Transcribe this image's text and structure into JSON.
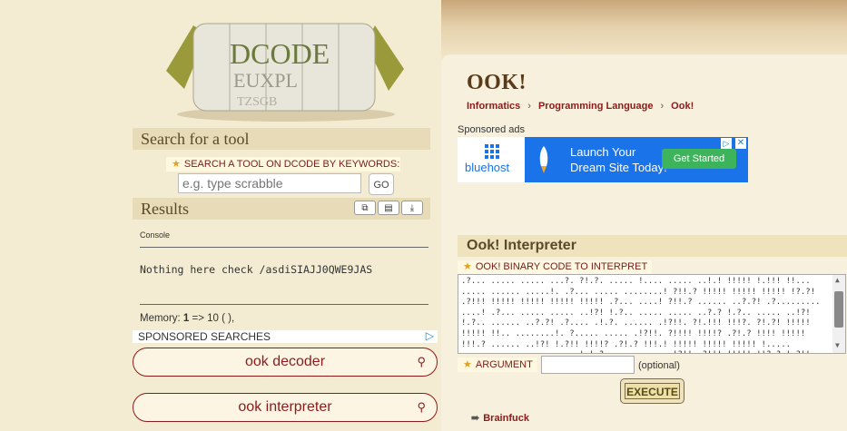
{
  "logo": {
    "letters_top": "DCODE",
    "letters_mid": "EUXPL",
    "letters_bot": "TZSGB"
  },
  "sidebar": {
    "search_header": "Search for a tool",
    "keyword_label": "SEARCH A TOOL ON DCODE BY KEYWORDS:",
    "search_placeholder": "e.g. type scrabble",
    "go_label": "GO",
    "results_header": "Results",
    "console_label": "Console",
    "console_text": "Nothing here check /asdiSIAJJ0QWE9JAS",
    "memory_prefix": "Memory: ",
    "memory_value": "1",
    "memory_suffix": " => 10 ( ),",
    "sponsored_searches": "SPONSORED SEARCHES",
    "ad_search_1": "ook decoder",
    "ad_search_2": "ook interpreter",
    "icons": [
      "copy-icon",
      "print-icon",
      "download-icon",
      "search-icon",
      "adchoices-icon"
    ]
  },
  "main": {
    "title": "OOK!",
    "breadcrumb": [
      "Informatics",
      "Programming Language",
      "Ook!"
    ],
    "sponsored_ads": "Sponsored ads",
    "ad": {
      "brand": "bluehost",
      "headline_1": "Launch Your",
      "headline_2": "Dream Site Today!",
      "cta": "Get Started"
    },
    "section_title": "Ook! Interpreter",
    "code_label": "OOK! BINARY CODE TO INTERPRET",
    "code_value": ".?... ..... ..... ...?. ?!.?. ..... !.... ..... ..!.! !!!!! !.!!! !!... ..... ...... .....!. .?... ..... ........! ?!!.? !!!!! !!!!! !!!!! !?.?! .?!!! !!!!! !!!!! !!!!! !!!!! .?... ....! ?!!.? ...... ..?.?! .?......... ....! .?... ..... ..... ..!?! !.?.. ..... ..... ..?.? !.?.. ..... ..!?! !.?.. ...... ..?.?! .?.... .!.?. ...... .!?!!. ?!.!!! !!!?. ?!.?! !!!!! !!!!! !!.. ........!. ?..... ..... .!?!!. ?!!!! !!!!? .?!.? !!!! !!!!! !!!.? ...... ..!?! !.?!! !!!!? .?!.? !!!.! !!!!! !!!!! !!!!! !..... ........ ...... ........!.!.? .... ...... .!?!! .?!!! !!!!! !!?.? !.?!! !.?.. ..... ...! ?!!.? ..... ..... ?.?!. ?...... ......!. ..... ......!.?. ...... ...!? !!.?! !!!!! !!?.? !.?!! !!!.? ...... .!?!.! !!!!? .?!.? !!!!! !!.? ......... !?.!! .? ......... ?.? !.? !!!.!!!! !!!! !!!!! !!!!! !.?.........!?!",
    "argument_label": "ARGUMENT",
    "argument_value": "",
    "optional": "(optional)",
    "execute": "EXECUTE",
    "related_link": "Brainfuck"
  },
  "colors": {
    "accent": "#8b1a1a",
    "panel": "#e8dcb8",
    "ad_blue": "#1a73e8",
    "ad_cta": "#3db35b"
  }
}
